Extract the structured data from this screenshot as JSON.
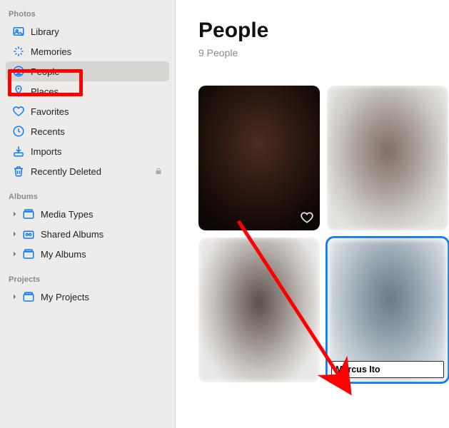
{
  "sidebar": {
    "sections": {
      "photos": {
        "title": "Photos",
        "items": [
          {
            "label": "Library",
            "icon": "photos-lib-icon"
          },
          {
            "label": "Memories",
            "icon": "sparkle-icon"
          },
          {
            "label": "People",
            "icon": "person-circle-icon",
            "selected": true,
            "highlight": true
          },
          {
            "label": "Places",
            "icon": "pin-icon"
          },
          {
            "label": "Favorites",
            "icon": "heart-icon"
          },
          {
            "label": "Recents",
            "icon": "clock-icon"
          },
          {
            "label": "Imports",
            "icon": "import-icon"
          },
          {
            "label": "Recently Deleted",
            "icon": "trash-icon",
            "trailing": "lock-icon"
          }
        ]
      },
      "albums": {
        "title": "Albums",
        "items": [
          {
            "label": "Media Types",
            "icon": "folder-icon",
            "chevron": true
          },
          {
            "label": "Shared Albums",
            "icon": "shared-folder-icon",
            "chevron": true
          },
          {
            "label": "My Albums",
            "icon": "folder-icon",
            "chevron": true
          }
        ]
      },
      "projects": {
        "title": "Projects",
        "items": [
          {
            "label": "My Projects",
            "icon": "folder-icon",
            "chevron": true
          }
        ]
      }
    }
  },
  "main": {
    "title": "People",
    "subtitle": "9 People",
    "tiles": [
      {
        "favorite": true
      },
      {
        "favorite": false
      },
      {
        "favorite": false
      },
      {
        "favorite": false,
        "selected": true,
        "name_input": "Marcus Ito"
      }
    ]
  },
  "annotation": {
    "color": "#ff0000"
  }
}
